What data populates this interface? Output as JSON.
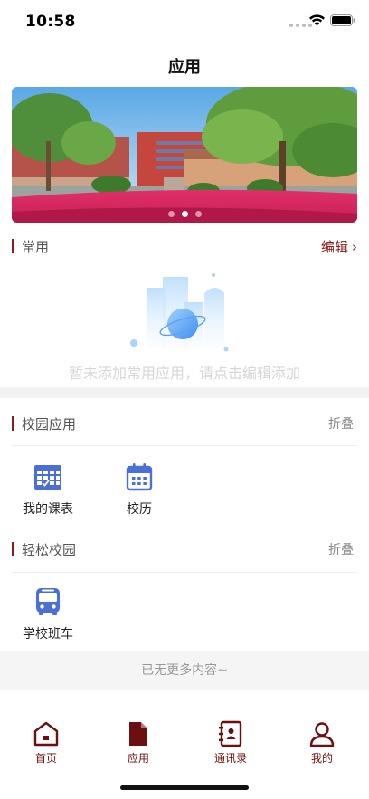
{
  "status_bar": {
    "time": "10:58"
  },
  "header": {
    "title": "应用"
  },
  "banner": {
    "image": "campus-photo",
    "page_count": 3,
    "active_page": 2
  },
  "common": {
    "title": "常用",
    "edit_label": "编辑",
    "edit_chevron": "›",
    "empty_text": "暂未添加常用应用，请点击编辑添加"
  },
  "campus_apps": {
    "title": "校园应用",
    "collapse_label": "折叠",
    "items": [
      {
        "label": "我的课表",
        "icon": "timetable-icon"
      },
      {
        "label": "校历",
        "icon": "calendar-icon"
      }
    ]
  },
  "easy_campus": {
    "title": "轻松校园",
    "collapse_label": "折叠",
    "items": [
      {
        "label": "学校班车",
        "icon": "bus-icon"
      }
    ]
  },
  "footer_note": "已无更多内容~",
  "tab_bar": {
    "items": [
      {
        "label": "首页",
        "icon": "home-icon",
        "active": false
      },
      {
        "label": "应用",
        "icon": "document-icon",
        "active": true
      },
      {
        "label": "通讯录",
        "icon": "contacts-icon",
        "active": false
      },
      {
        "label": "我的",
        "icon": "user-icon",
        "active": false
      }
    ]
  },
  "colors": {
    "accent": "#8b1a1a",
    "tile_icon": "#4a6fd8",
    "tab_icon": "#6b0f0f"
  }
}
